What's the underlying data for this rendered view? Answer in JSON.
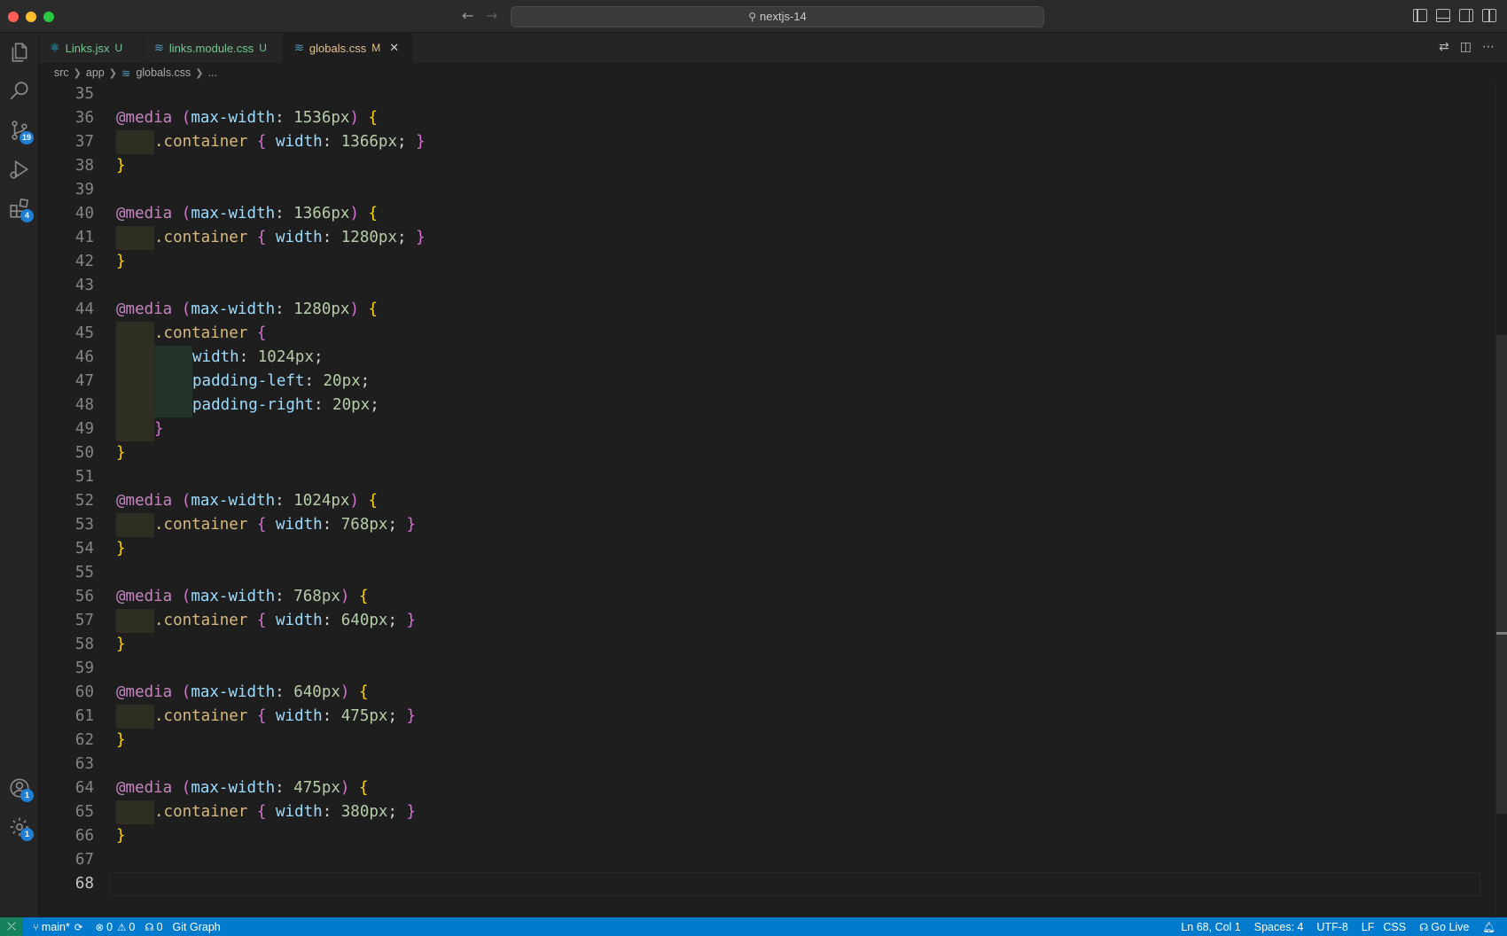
{
  "window": {
    "search_text": "nextjs-14"
  },
  "activity_bar": {
    "source_control_badge": "19",
    "extensions_badge": "4",
    "accounts_badge": "1",
    "settings_badge": "1"
  },
  "tabs": [
    {
      "name": "Links.jsx",
      "status": "U",
      "icon": "react-icon"
    },
    {
      "name": "links.module.css",
      "status": "U",
      "icon": "css-file-icon"
    },
    {
      "name": "globals.css",
      "status": "M",
      "icon": "css-file-icon",
      "active": true
    }
  ],
  "breadcrumb": {
    "parts": [
      "src",
      "app",
      "globals.css",
      "..."
    ]
  },
  "editor": {
    "active_line": 68,
    "lines": [
      {
        "n": "35"
      },
      {
        "n": "36"
      },
      {
        "n": "37"
      },
      {
        "n": "38"
      },
      {
        "n": "39"
      },
      {
        "n": "40"
      },
      {
        "n": "41"
      },
      {
        "n": "42"
      },
      {
        "n": "43"
      },
      {
        "n": "44"
      },
      {
        "n": "45"
      },
      {
        "n": "46"
      },
      {
        "n": "47"
      },
      {
        "n": "48"
      },
      {
        "n": "49"
      },
      {
        "n": "50"
      },
      {
        "n": "51"
      },
      {
        "n": "52"
      },
      {
        "n": "53"
      },
      {
        "n": "54"
      },
      {
        "n": "55"
      },
      {
        "n": "56"
      },
      {
        "n": "57"
      },
      {
        "n": "58"
      },
      {
        "n": "59"
      },
      {
        "n": "60"
      },
      {
        "n": "61"
      },
      {
        "n": "62"
      },
      {
        "n": "63"
      },
      {
        "n": "64"
      },
      {
        "n": "65"
      },
      {
        "n": "66"
      },
      {
        "n": "67"
      },
      {
        "n": "68"
      }
    ],
    "tokens": {
      "at_media": "@media",
      "max_width": "max-width",
      "container": ".container",
      "width": "width",
      "padding_left": "padding-left",
      "padding_right": "padding-right",
      "v1536": "1536px",
      "v1366": "1366px",
      "v1280": "1280px",
      "v1024": "1024px",
      "v768": "768px",
      "v640": "640px",
      "v475": "475px",
      "v380": "380px",
      "v20": "20px"
    }
  },
  "status_bar": {
    "branch": "main*",
    "errors": "0",
    "warnings": "0",
    "ports": "0",
    "git_graph": "Git Graph",
    "position": "Ln 68, Col 1",
    "spaces": "Spaces: 4",
    "encoding": "UTF-8",
    "eol": "LF",
    "language": "CSS",
    "go_live": "Go Live"
  },
  "colors": {
    "status_bar": "#007acc",
    "remote_indicator": "#16825d",
    "badge": "#1f7fd4"
  }
}
